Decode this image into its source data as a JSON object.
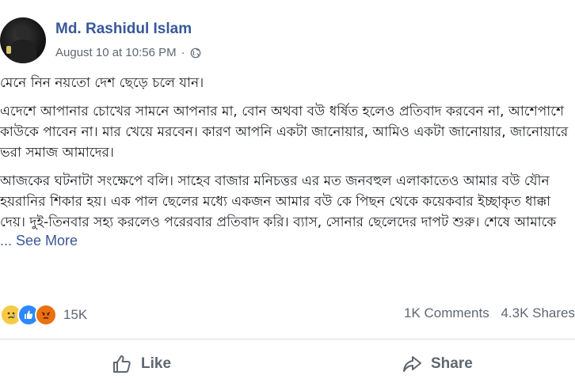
{
  "post": {
    "author": "Md. Rashidul Islam",
    "timestamp": "August 10 at 10:56 PM",
    "separator": "·",
    "paragraphs": [
      "মেনে নিন নয়তো দেশ ছেড়ে চলে যান।",
      "এদেশে আপানার চোখের সামনে আপনার মা, বোন অথবা বউ ধর্ষিত হলেও প্রতিবাদ করবেন না, আশেপাশে কাউকে পাবেন না। মার খেয়ে মরবেন। কারণ আপনি একটা জানোয়ার, আমিও একটা জানোয়ার, জানোয়ারে ভরা সমাজ আমাদের।",
      "আজকের ঘটনাটা সংক্ষেপে বলি। সাহেব বাজার মনিচত্তর এর মত জনবহুল এলাকাতেও আমার বউ যৌন হয়রানির শিকার হয়। এক পাল ছেলের মধ্যে একজন আমার বউ কে পিছন থেকে কয়েকবার ইচ্ছাকৃত ধাক্কা দেয়। দুই-তিনবার সহ্য করলেও পরেরবার প্রতিবাদ করি। ব্যাস, সোনার ছেলেদের দাপট শুরু। শেষে আমাকে"
    ],
    "see_more": "... See More"
  },
  "stats": {
    "reaction_count": "15K",
    "comments": "1K Comments",
    "shares": "4.3K Shares"
  },
  "actions": {
    "like_label": "Like",
    "share_label": "Share"
  },
  "colors": {
    "link_blue": "#385898",
    "meta_gray": "#606770",
    "text": "#1c1e21"
  }
}
